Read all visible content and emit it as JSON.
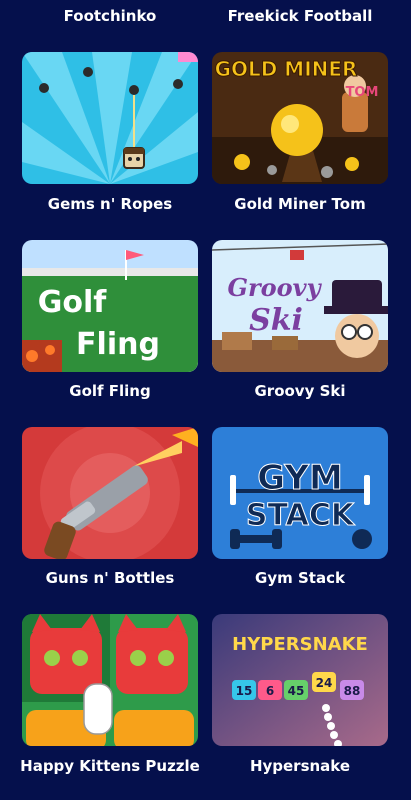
{
  "top_row": [
    {
      "title": "Footchinko"
    },
    {
      "title": "Freekick Football"
    }
  ],
  "games": [
    {
      "title": "Gems n' Ropes",
      "art": {
        "colors": {
          "bg": "#2fbfe6",
          "ray": "#69d7f3"
        }
      }
    },
    {
      "title": "Gold Miner Tom",
      "art": {
        "logo_text": "GOLD MINER",
        "logo_sub": "TOM",
        "colors": {
          "bg": "#4a2a12",
          "gold": "#f5c21a"
        }
      }
    },
    {
      "title": "Golf Fling",
      "art": {
        "logo_line1": "Golf",
        "logo_line2": "Fling",
        "colors": {
          "grass": "#2f8f3a",
          "sky": "#bfe0ff",
          "lava": "#b43a1e"
        }
      }
    },
    {
      "title": "Groovy Ski",
      "art": {
        "logo_line1": "Groovy",
        "logo_line2": "Ski",
        "colors": {
          "sky": "#d8eefc",
          "logo": "#7b3fa0"
        }
      }
    },
    {
      "title": "Guns n' Bottles",
      "art": {
        "colors": {
          "bg": "#d43a3a",
          "flame": "#ffb020"
        }
      }
    },
    {
      "title": "Gym Stack",
      "art": {
        "logo_line1": "GYM",
        "logo_line2": "STACK",
        "colors": {
          "bg": "#2d7fd8",
          "plate": "#0f2a55"
        }
      }
    },
    {
      "title": "Happy Kittens Puzzle",
      "art": {
        "colors": {
          "cat_red": "#e83b3b",
          "tile_green": "#2e9b4a",
          "cat_orange": "#f7a21a"
        }
      }
    },
    {
      "title": "Hypersnake",
      "art": {
        "logo_text": "HYPERSNAKE",
        "numbers": [
          "15",
          "6",
          "45",
          "24",
          "88"
        ],
        "colors": {
          "bg": "#4a4a8c",
          "logo": "#ffd84a"
        }
      }
    }
  ]
}
